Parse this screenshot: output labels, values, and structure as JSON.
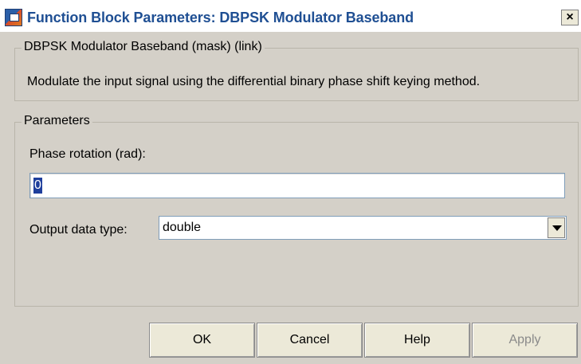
{
  "window": {
    "title": "Function Block Parameters: DBPSK Modulator Baseband",
    "close_glyph": "×"
  },
  "description": {
    "legend": "DBPSK Modulator Baseband (mask) (link)",
    "text": "Modulate the input signal using the differential binary phase shift keying method."
  },
  "parameters": {
    "legend": "Parameters",
    "phase_rotation": {
      "label": "Phase rotation (rad):",
      "value": "0"
    },
    "output_data_type": {
      "label": "Output data type:",
      "value": "double"
    }
  },
  "buttons": {
    "ok": "OK",
    "cancel": "Cancel",
    "help": "Help",
    "apply": "Apply"
  },
  "icons": {
    "window": "simulink-block-icon",
    "dropdown": "chevron-down-icon"
  }
}
